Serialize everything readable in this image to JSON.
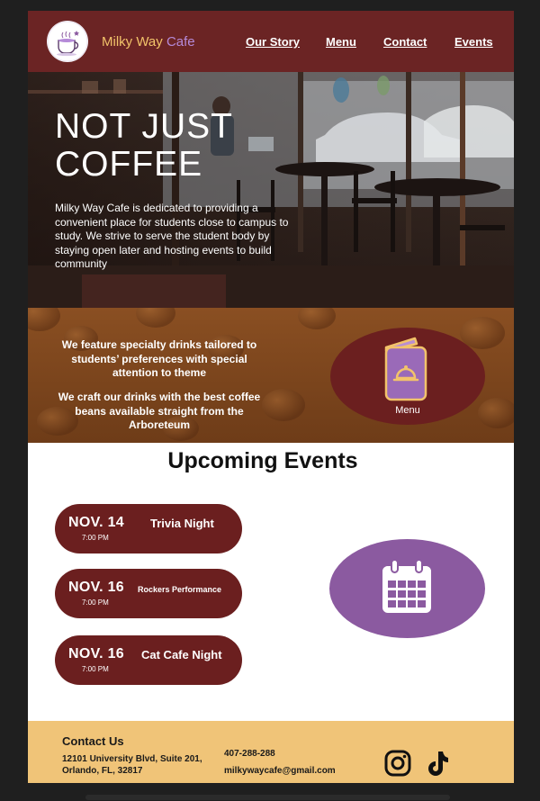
{
  "brand": {
    "word1": "Milky Way",
    "word2": "Cafe"
  },
  "nav": [
    {
      "label": "Our Story"
    },
    {
      "label": "Menu"
    },
    {
      "label": "Contact"
    },
    {
      "label": "Events"
    }
  ],
  "hero": {
    "title": "NOT JUST COFFEE",
    "text": "Milky Way Cafe is dedicated to providing a convenient place for students close to campus to study. We strive to serve the student body by staying open later and hosting events to build community"
  },
  "specialty": {
    "p1": "We feature specialty drinks tailored to students’ preferences with special attention to theme",
    "p2": "We craft our drinks with the best coffee beans available straight from the Arboreteum",
    "menu_label": "Menu"
  },
  "events": {
    "title": "Upcoming Events",
    "items": [
      {
        "date": "NOV. 14",
        "time": "7:00 PM",
        "name": "Trivia Night"
      },
      {
        "date": "NOV. 16",
        "time": "7:00 PM",
        "name": "Rockers Performance"
      },
      {
        "date": "NOV. 16",
        "time": "7:00 PM",
        "name": "Cat Cafe Night"
      }
    ]
  },
  "footer": {
    "heading": "Contact Us",
    "address": "12101 University Blvd, Suite 201, Orlando, FL, 32817",
    "phone": "407-288-288",
    "email": "milkywaycafe@gmail.com"
  },
  "colors": {
    "maroon": "#6b2424",
    "gold": "#f2c36a",
    "lavender": "#b58ad8",
    "purple": "#8b5aa0",
    "footer": "#f0c478"
  },
  "icons": [
    "coffee-cup-logo",
    "menu-book-icon",
    "calendar-icon",
    "instagram-icon",
    "tiktok-icon"
  ]
}
